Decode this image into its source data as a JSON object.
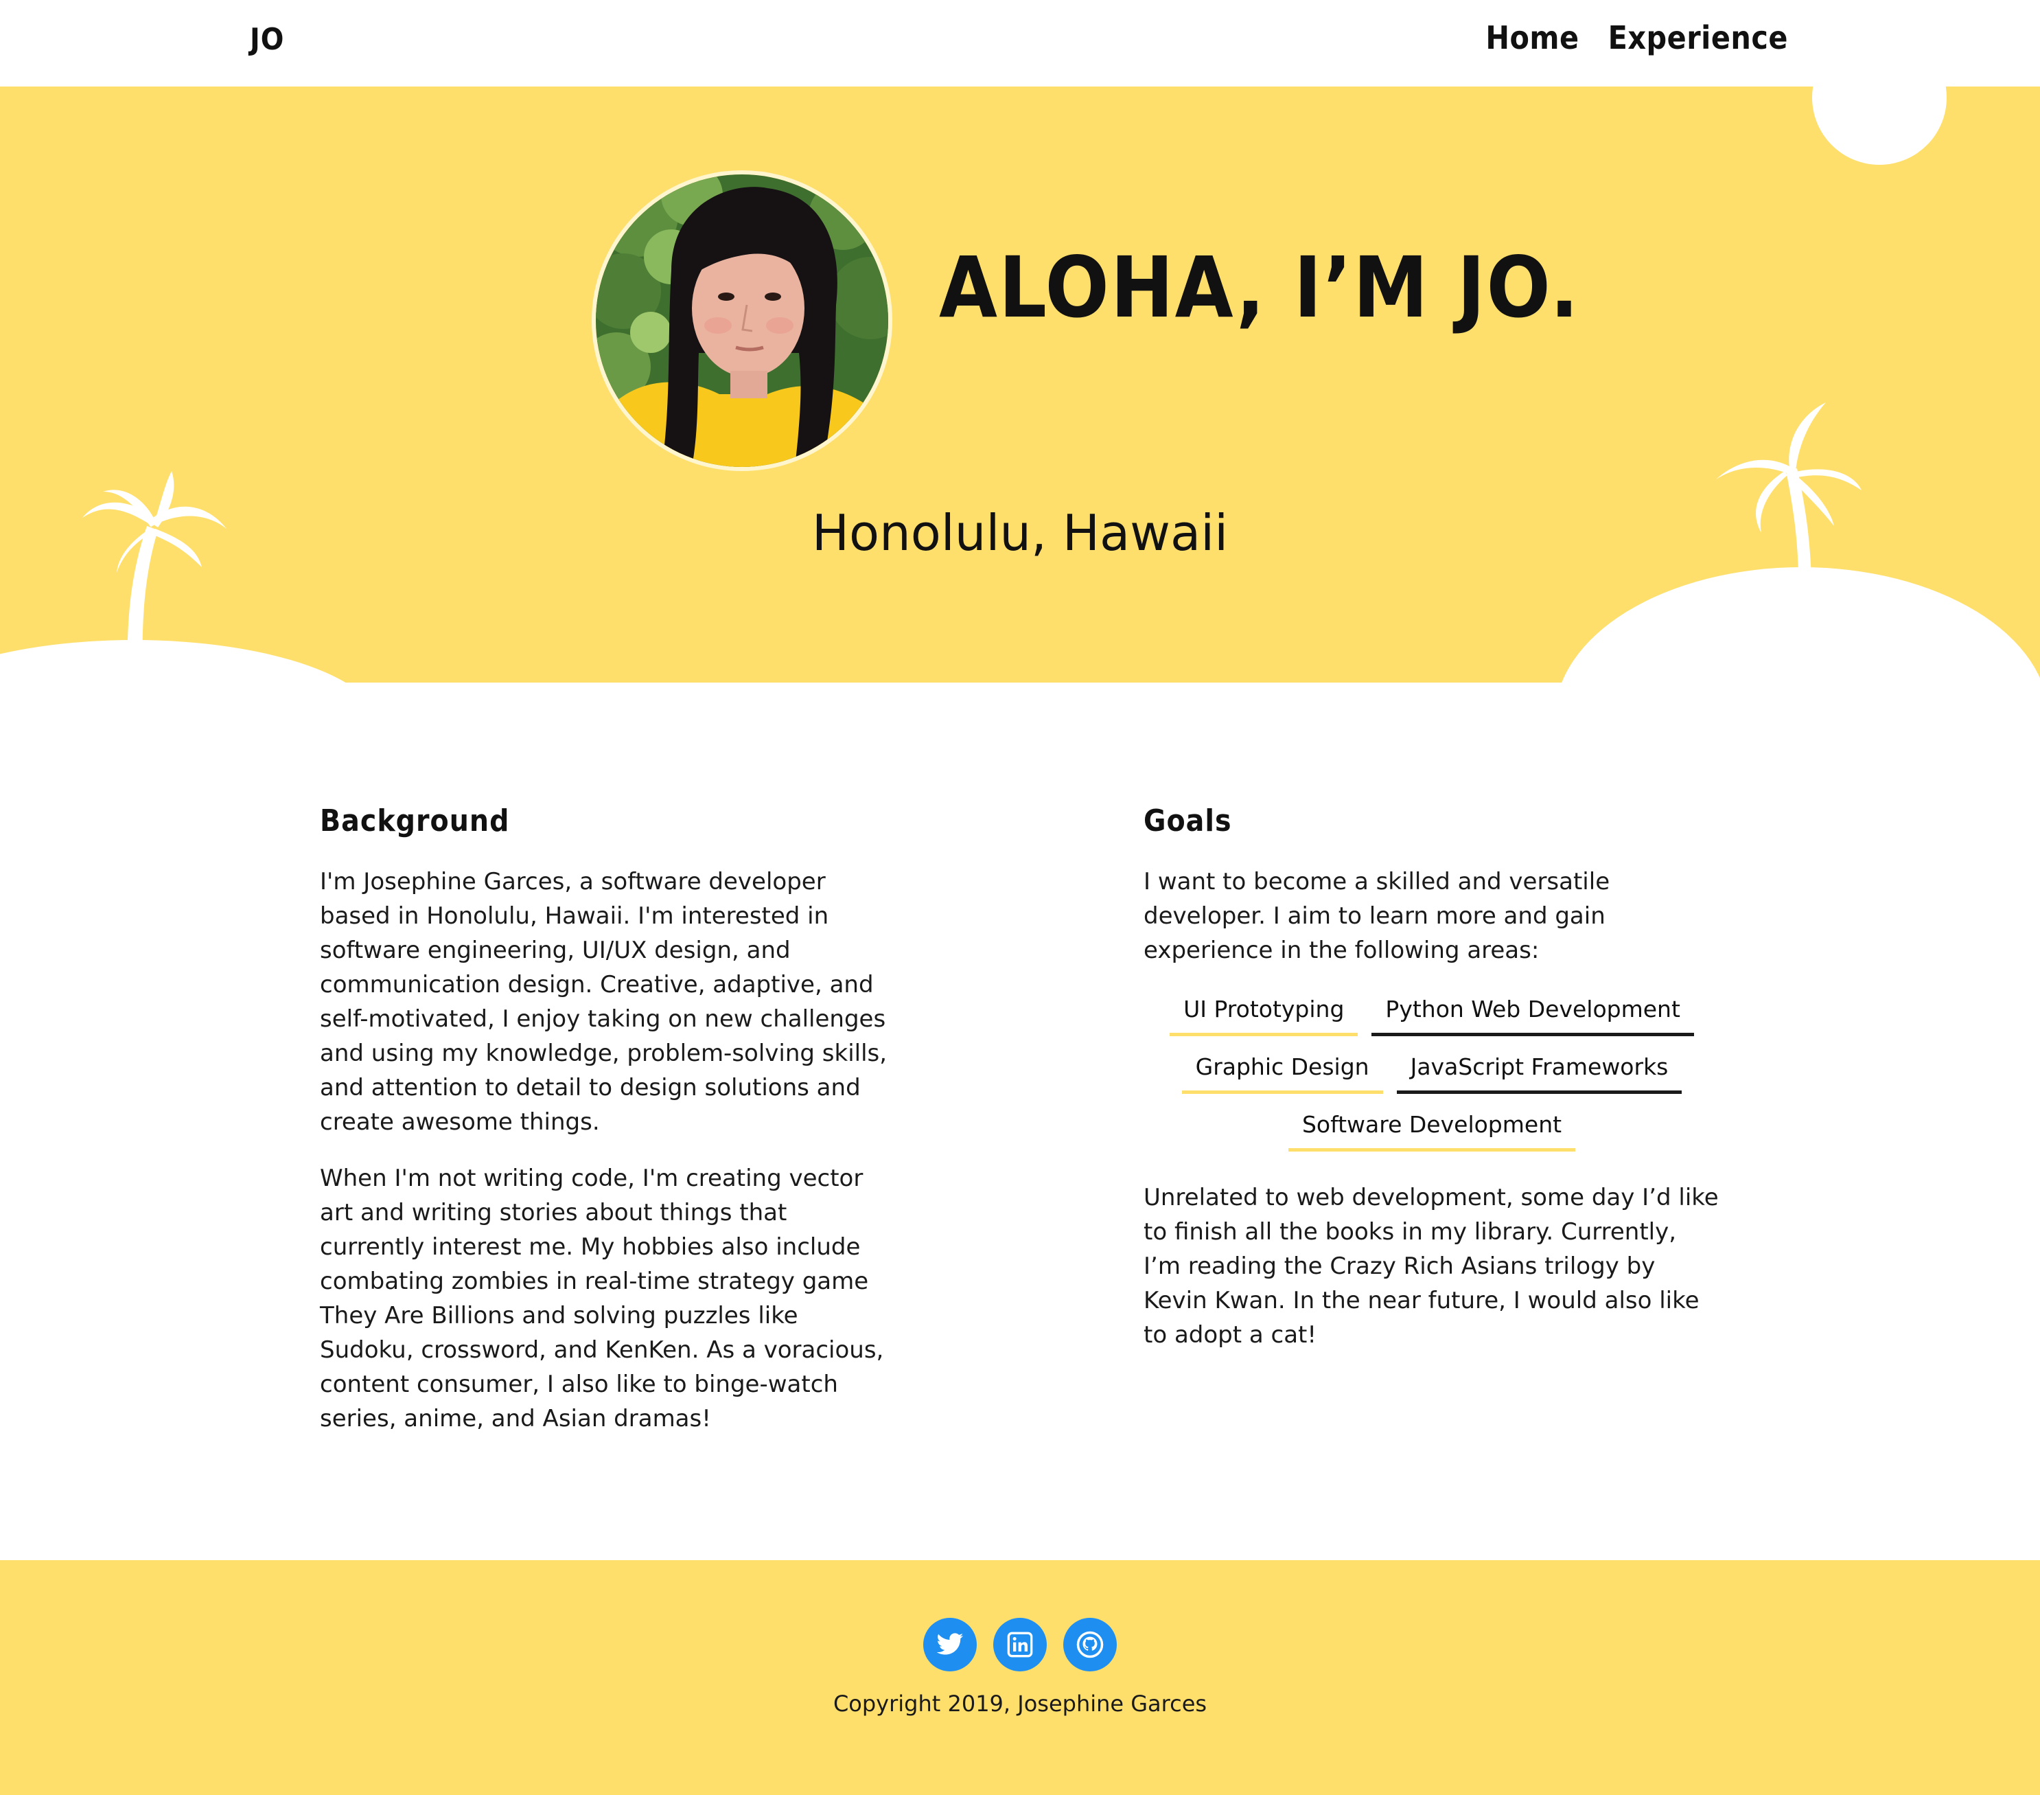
{
  "nav": {
    "brand": "JO",
    "links": [
      {
        "label": "Home"
      },
      {
        "label": "Experience"
      }
    ]
  },
  "hero": {
    "title": "ALOHA, I’M JO.",
    "location": "Honolulu, Hawaii",
    "avatar_alt": "Portrait photo"
  },
  "background": {
    "heading": "Background",
    "paragraphs": [
      "I'm Josephine Garces, a software developer based in Honolulu, Hawaii. I'm interested in software engineering, UI/UX design, and communication design. Creative, adaptive, and self-motivated, I enjoy taking on new challenges and using my knowledge, problem-solving skills, and attention to detail to design solutions and create awesome things.",
      "When I'm not writing code, I'm creating vector art and writing stories about things that currently interest me. My hobbies also include combating zombies in real-time strategy game They Are Billions and solving puzzles like Sudoku, crossword, and KenKen. As a voracious, content consumer, I also like to binge-watch series, anime, and Asian dramas!"
    ]
  },
  "goals": {
    "heading": "Goals",
    "intro": "I want to become a skilled and versatile developer. I aim to learn more and gain experience in the following areas:",
    "tags": [
      {
        "label": "UI Prototyping",
        "underline": "yellow"
      },
      {
        "label": "Python Web Development",
        "underline": "dark"
      },
      {
        "label": "Graphic Design",
        "underline": "yellow"
      },
      {
        "label": "JavaScript Frameworks",
        "underline": "dark"
      },
      {
        "label": "Software Development",
        "underline": "yellow"
      }
    ],
    "outro": "Unrelated to web development, some day I’d like to finish all the books in my library. Currently, I’m reading the Crazy Rich Asians trilogy by Kevin Kwan. In the near future, I would also like to adopt a cat!"
  },
  "footer": {
    "socials": [
      {
        "icon": "twitter-icon"
      },
      {
        "icon": "linkedin-icon"
      },
      {
        "icon": "github-icon"
      }
    ],
    "copyright": "Copyright 2019, Josephine Garces"
  },
  "colors": {
    "accent_yellow": "#fedf6c",
    "social_blue": "#1e8ff0",
    "text": "#1a1a1a"
  }
}
